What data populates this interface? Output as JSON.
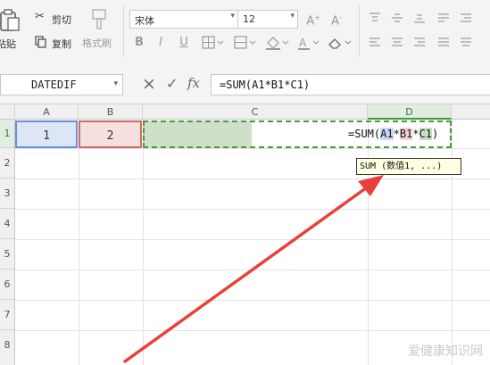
{
  "ribbon": {
    "paste_label": "粘贴",
    "cut_label": "剪切",
    "copy_label": "复制",
    "format_painter_label": "格式刷",
    "font_name": "宋体",
    "font_size": "12"
  },
  "formula_bar": {
    "name_box": "DATEDIF",
    "cancel_icon": "×",
    "confirm_icon": "✓",
    "fx_label": "fx",
    "formula": "=SUM(A1*B1*C1)"
  },
  "columns": [
    "A",
    "B",
    "C",
    "D"
  ],
  "rows": [
    "1",
    "2",
    "3",
    "4",
    "5",
    "6",
    "7",
    "8"
  ],
  "cells": {
    "A1": "1",
    "B1": "2",
    "D1_prefix": "=SUM(",
    "D1_refA": "A1",
    "D1_op1": "*",
    "D1_refB": "B1",
    "D1_op2": "*",
    "D1_refC": "C1",
    "D1_suffix": ")"
  },
  "tooltip": "SUM (数值1, ...)",
  "watermark": "爱健康知识网",
  "colors": {
    "ref_a": "#6c8ed4",
    "ref_b": "#cf6b64",
    "ref_c": "#4a9a3a",
    "annotation_arrow": "#e8413b"
  }
}
